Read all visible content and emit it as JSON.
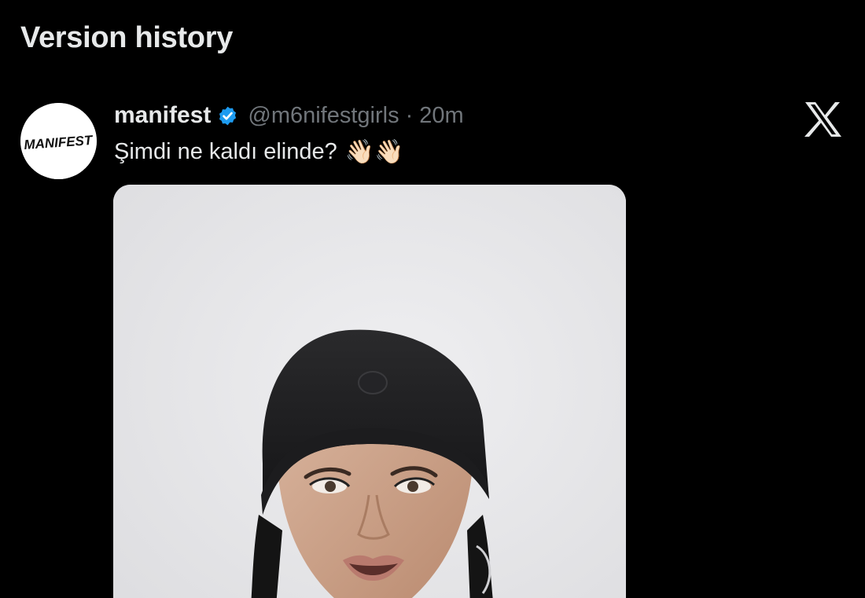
{
  "page": {
    "title": "Version history"
  },
  "tweet": {
    "avatar_text": "MANIFEST",
    "display_name": "manifest",
    "verified": true,
    "handle": "@m6nifestgirls",
    "separator": "·",
    "time": "20m",
    "text": "Şimdi ne kaldı elinde?",
    "emojis": "👋🏻👋🏻",
    "source_icon": "x-logo-icon",
    "media": {
      "type": "photo",
      "description_icon": "photo-icon"
    }
  },
  "colors": {
    "background": "#000000",
    "primary_text": "#e7e9ea",
    "secondary_text": "#71767b",
    "verified": "#1d9bf0"
  }
}
